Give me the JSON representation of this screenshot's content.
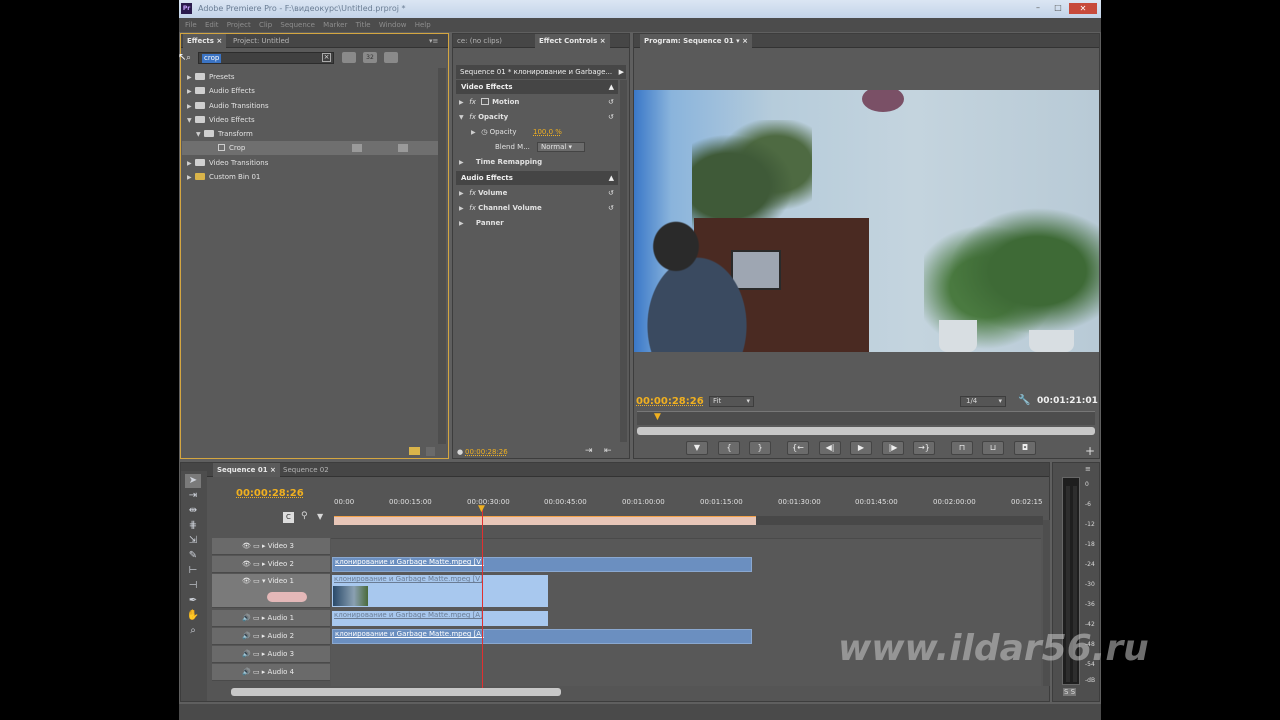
{
  "app": {
    "title": "Adobe Premiere Pro - F:\\видеокурс\\Untitled.prproj *",
    "logo": "Pr"
  },
  "menu": [
    "File",
    "Edit",
    "Project",
    "Clip",
    "Sequence",
    "Marker",
    "Title",
    "Window",
    "Help"
  ],
  "effects_panel": {
    "tabs": [
      "Effects",
      "Project: Untitled"
    ],
    "search_value": "crop",
    "items": [
      {
        "label": "Presets",
        "expanded": false
      },
      {
        "label": "Audio Effects",
        "expanded": false
      },
      {
        "label": "Audio Transitions",
        "expanded": false
      },
      {
        "label": "Video Effects",
        "expanded": true
      },
      {
        "label": "Transform",
        "expanded": true
      },
      {
        "label": "Crop",
        "selected": true
      },
      {
        "label": "Video Transitions",
        "expanded": false
      },
      {
        "label": "Custom Bin 01",
        "expanded": false
      }
    ]
  },
  "effect_controls": {
    "tabs": [
      "ce: (no clips)",
      "Effect Controls"
    ],
    "sequence_label": "Sequence 01 * клонирование и Garbage...",
    "video_header": "Video Effects",
    "motion": "Motion",
    "opacity": "Opacity",
    "opacity_param": "Opacity",
    "opacity_value": "100,0 %",
    "blend_label": "Blend M...",
    "blend_value": "Normal",
    "time_remap": "Time Remapping",
    "audio_header": "Audio Effects",
    "volume": "Volume",
    "channel_volume": "Channel Volume",
    "panner": "Panner",
    "timecode": "00:00:28:26"
  },
  "program": {
    "tab": "Program: Sequence 01",
    "timecode": "00:00:28:26",
    "fit": "Fit",
    "resolution": "1/4",
    "duration": "00:01:21:01"
  },
  "timeline": {
    "tabs": [
      "Sequence 01",
      "Sequence 02"
    ],
    "timecode": "00:00:28:26",
    "ruler": [
      "00:00",
      "00:00:15:00",
      "00:00:30:00",
      "00:00:45:00",
      "00:01:00:00",
      "00:01:15:00",
      "00:01:30:00",
      "00:01:45:00",
      "00:02:00:00",
      "00:02:15"
    ],
    "tracks": [
      "Video 3",
      "Video 2",
      "Video 1",
      "Audio 1",
      "Audio 2",
      "Audio 3",
      "Audio 4"
    ],
    "clips": {
      "v2": "клонирование и Garbage Matte.mpeg [V]",
      "v1": "клонирование и Garbage Matte.mpeg [V]",
      "a1": "клонирование и Garbage Matte.mpeg [A]",
      "a2": "клонирование и Garbage Matte.mpeg [A]"
    }
  },
  "meter": {
    "scale": [
      "0",
      "-6",
      "-12",
      "-18",
      "-24",
      "-30",
      "-36",
      "-42",
      "-48",
      "-54",
      "-dB"
    ],
    "solo": "S S"
  },
  "watermark": "www.ildar56.ru",
  "colors": {
    "accent_timecode": "#f0b020",
    "clip_blue": "#6b8fc0",
    "playhead": "#e03030"
  }
}
